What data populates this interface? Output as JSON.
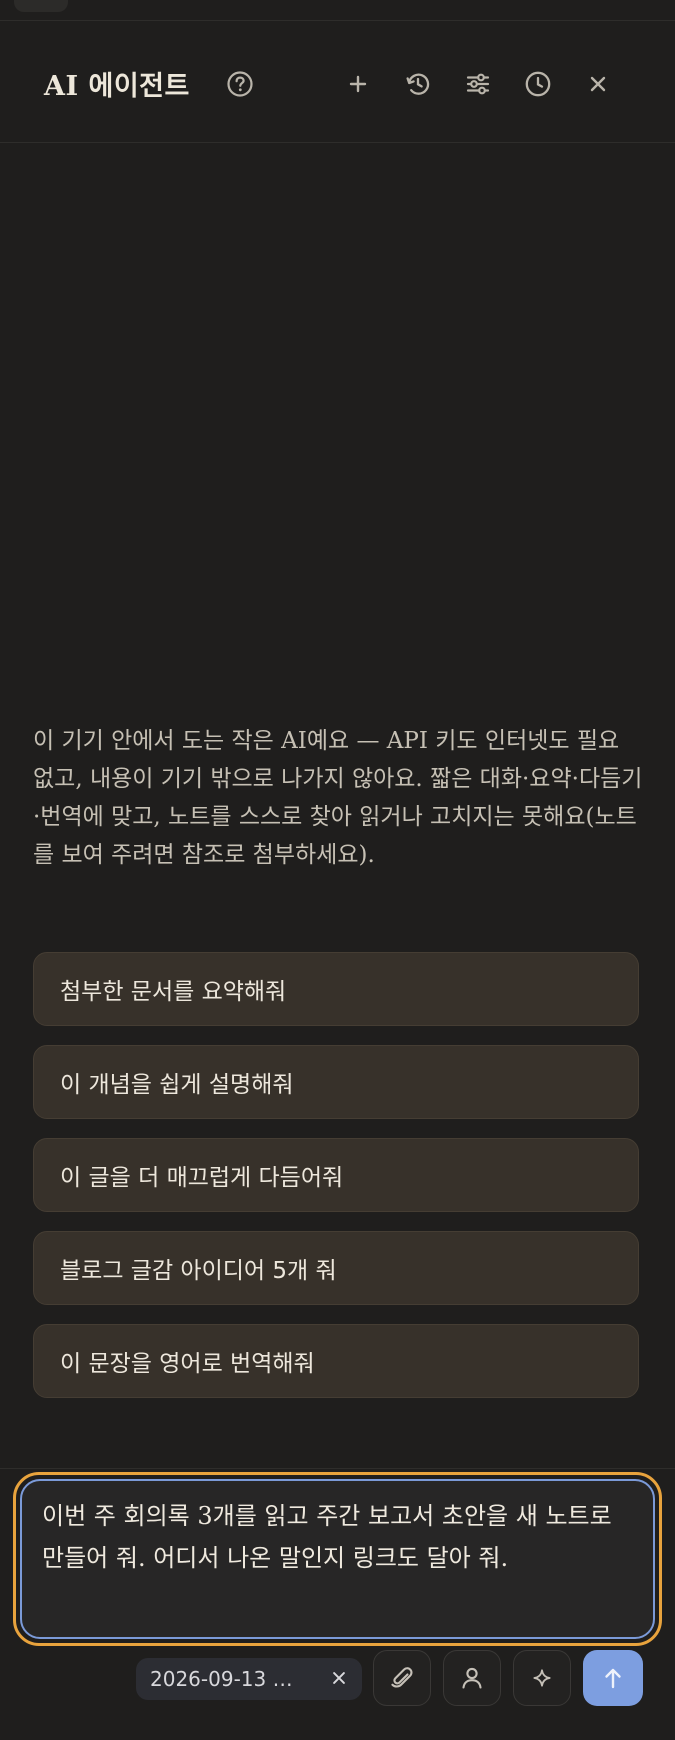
{
  "header": {
    "title": "AI 에이전트",
    "icons": [
      "help-icon",
      "plus-icon",
      "history-icon",
      "sliders-icon",
      "clock-icon",
      "close-icon"
    ]
  },
  "intro": {
    "text": "이 기기 안에서 도는 작은 AI예요 — API 키도 인터넷도 필요 없고, 내용이 기기 밖으로 나가지 않아요. 짧은 대화·요약·다듬기·번역에 맞고, 노트를 스스로 찾아 읽거나 고치지는 못해요(노트를 보여 주려면 참조로 첨부하세요)."
  },
  "suggestions": [
    "첨부한 문서를 요약해줘",
    "이 개념을 쉽게 설명해줘",
    "이 글을 더 매끄럽게 다듬어줘",
    "블로그 글감 아이디어 5개 줘",
    "이 문장을 영어로 번역해줘"
  ],
  "composer": {
    "value": "이번 주 회의록 3개를 읽고 주간 보고서 초안을 새 노트로 만들어 줘. 어디서 나온 말인지 링크도 달아 줘."
  },
  "attachment_chip": {
    "label": "2026-09-13 …"
  },
  "toolbar": {
    "icons": [
      "paperclip-icon",
      "person-icon",
      "sparkle-icon",
      "arrow-up-icon"
    ]
  },
  "colors": {
    "background": "#1f1e1d",
    "suggestion_bg": "#37312a",
    "focus_ring": "#e8a33d",
    "input_border": "#7b9ad8",
    "send_button": "#7d9ee0"
  }
}
